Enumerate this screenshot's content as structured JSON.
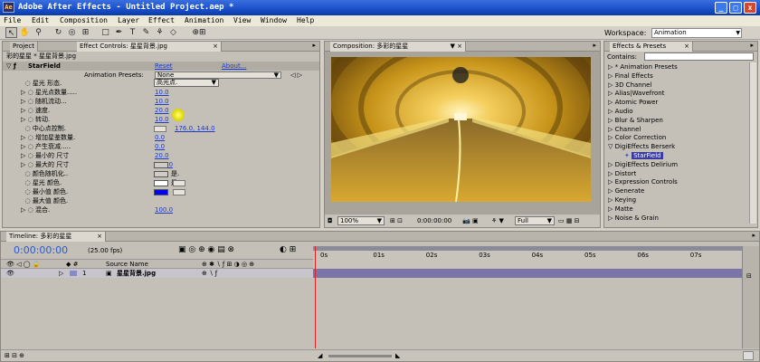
{
  "window": {
    "title": "Adobe After Effects - Untitled Project.aep *",
    "min": "_",
    "max": "□",
    "close": "x"
  },
  "menu": [
    "File",
    "Edit",
    "Composition",
    "Layer",
    "Effect",
    "Animation",
    "View",
    "Window",
    "Help"
  ],
  "workspace": {
    "label": "Workspace:",
    "value": "Animation"
  },
  "project_tab": "Project",
  "effect_controls": {
    "tab": "Effect Controls: 星星背景.jpg",
    "breadcrumb": "彩的星星 * 星星背景.jpg",
    "effect_name": "StarField",
    "reset": "Reset",
    "about": "About...",
    "presets_label": "Animation Presets:",
    "presets_value": "None",
    "params": [
      {
        "name": "星光 形态.",
        "value": "高光点."
      },
      {
        "name": "星光点数量.....",
        "value": "10.0"
      },
      {
        "name": "随机流动...",
        "value": "10.0"
      },
      {
        "name": "速度.",
        "value": "20.0"
      },
      {
        "name": "转动.",
        "value": "10.0"
      },
      {
        "name": "中心点控制.",
        "value": "176.0, 144.0"
      },
      {
        "name": "增加星鉴数量.",
        "value": "0.0"
      },
      {
        "name": "产生衰减.....",
        "value": "0.0"
      },
      {
        "name": "最小的 尺寸",
        "value": "20.0"
      },
      {
        "name": "最大的 尺寸",
        "value": "310.0"
      },
      {
        "name": "颜色随机化..",
        "value": "是."
      },
      {
        "name": "星光 颜色.",
        "value": "是."
      },
      {
        "name": "最小值 颜色.",
        "value": ""
      },
      {
        "name": "最大值 颜色.",
        "value": ""
      },
      {
        "name": "混合.",
        "value": "100.0"
      }
    ],
    "colors": {
      "min": "#ffffff",
      "max": "#0000ff"
    }
  },
  "composition": {
    "tab": "Composition: 多彩的星星",
    "zoom": "100%",
    "timecode": "0:00:00:00",
    "resolution": "Full"
  },
  "effects_presets": {
    "tab": "Effects & Presets",
    "contains_label": "Contains:",
    "items": [
      "* Animation Presets",
      "Final Effects",
      "3D Channel",
      "Alias|Wavefront",
      "Atomic Power",
      "Audio",
      "Blur & Sharpen",
      "Channel",
      "Color Correction",
      "DigiEffects Berserk",
      "StarField",
      "DigiEffects Delirium",
      "Distort",
      "Expression Controls",
      "Generate",
      "Keying",
      "Matte",
      "Noise & Grain"
    ]
  },
  "timeline": {
    "tab": "Timeline: 多彩的星星",
    "timecode": "0:00:00:00",
    "fps": "(25.00 fps)",
    "source_name_header": "Source Name",
    "layer_number": "1",
    "layer_name": "星星背景.jpg",
    "ruler": [
      "0s",
      "01s",
      "02s",
      "03s",
      "04s",
      "05s",
      "06s",
      "07s",
      "08s"
    ]
  },
  "colors": {
    "titlebar": "#1a4fc8",
    "accent_blue": "#1a3ad0",
    "timecode": "#2a5ad0"
  }
}
